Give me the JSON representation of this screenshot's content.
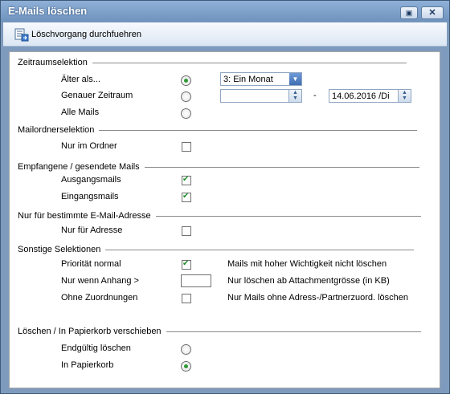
{
  "window": {
    "title": "E-Mails löschen"
  },
  "toolbar": {
    "action_label": "Löschvorgang durchfuehren"
  },
  "zeitraum": {
    "section": "Zeitraumselektion",
    "aelter_als": "Älter als...",
    "genauer_zeitraum": "Genauer Zeitraum",
    "alle_mails": "Alle Mails",
    "period_value": "3: Ein Monat",
    "date_from": "",
    "dash": "-",
    "date_to": "14.06.2016 /Di",
    "selected": "aelter_als"
  },
  "mailordner": {
    "section": "Mailordnerselektion",
    "nur_im_ordner": "Nur im Ordner",
    "nur_im_ordner_checked": false
  },
  "empfangen": {
    "section": "Empfangene / gesendete Mails",
    "ausgangsmails": "Ausgangsmails",
    "ausgangsmails_checked": true,
    "eingangsmails": "Eingangsmails",
    "eingangsmails_checked": true
  },
  "adresse": {
    "section": "Nur für bestimmte E-Mail-Adresse",
    "nur_fuer_adresse": "Nur für Adresse",
    "checked": false
  },
  "sonstige": {
    "section": "Sonstige Selektionen",
    "prioritaet": "Priorität normal",
    "prioritaet_checked": true,
    "prioritaet_desc": "Mails mit hoher Wichtigkeit nicht löschen",
    "anhang": "Nur wenn Anhang >",
    "anhang_value": "",
    "anhang_desc": "Nur löschen ab Attachmentgrösse (in KB)",
    "ohne_zuordnungen": "Ohne Zuordnungen",
    "ohne_checked": false,
    "ohne_desc": "Nur Mails ohne Adress-/Partnerzuord. löschen"
  },
  "loeschen": {
    "section": "Löschen / In Papierkorb verschieben",
    "endgueltig": "Endgültig löschen",
    "papierkorb": "In Papierkorb",
    "selected": "papierkorb"
  },
  "icons": {
    "restore": "restore-icon",
    "close": "close-icon",
    "action": "delete-run-icon"
  }
}
